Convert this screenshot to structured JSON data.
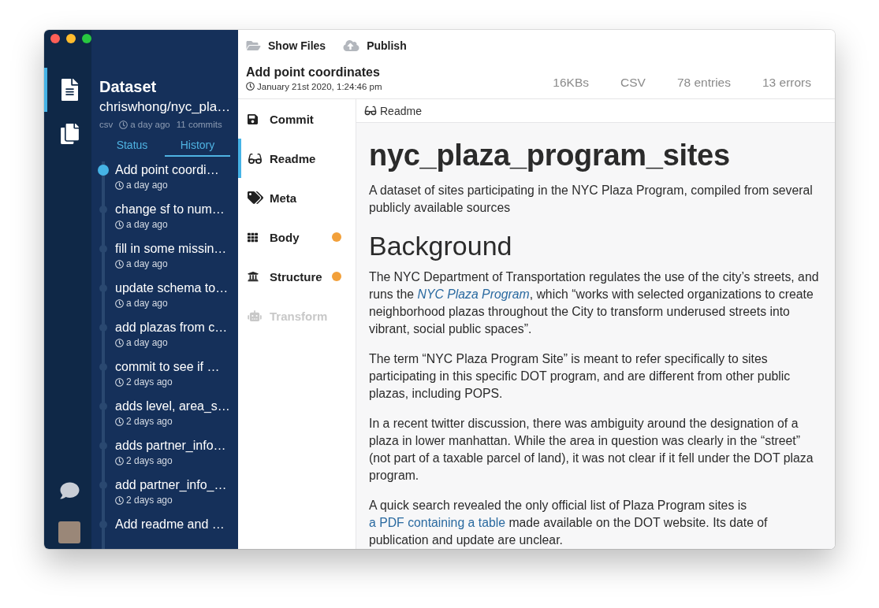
{
  "rail": [
    {
      "selected": true
    },
    {
      "selected": false
    }
  ],
  "sidebar": {
    "title": "Dataset",
    "name": "chriswhong/nyc_pla…",
    "format": "csv",
    "updated": "a day ago",
    "commits": "11 commits"
  },
  "history_tabs": [
    {
      "label": "Status",
      "selected": false
    },
    {
      "label": "History",
      "selected": true
    }
  ],
  "history": [
    {
      "message": "Add point coordi…",
      "time": "a day ago",
      "selected": true
    },
    {
      "message": "change sf to num…",
      "time": "a day ago",
      "selected": false
    },
    {
      "message": "fill in some missin…",
      "time": "a day ago",
      "selected": false
    },
    {
      "message": "update schema to…",
      "time": "a day ago",
      "selected": false
    },
    {
      "message": "add plazas from c…",
      "time": "a day ago",
      "selected": false
    },
    {
      "message": "commit to see if …",
      "time": "2 days ago",
      "selected": false
    },
    {
      "message": "adds level, area_s…",
      "time": "2 days ago",
      "selected": false
    },
    {
      "message": "adds partner_info…",
      "time": "2 days ago",
      "selected": false
    },
    {
      "message": "add partner_info_…",
      "time": "2 days ago",
      "selected": false
    },
    {
      "message": "Add readme and …",
      "selected": false
    }
  ],
  "toolbar": [
    "Show Files",
    "Publish"
  ],
  "commit": {
    "title": "Add point coordinates",
    "timestamp": "January 21st 2020, 1:24:46 pm",
    "stats": [
      "16KBs",
      "CSV",
      "78 entries",
      "13 errors"
    ]
  },
  "sections": [
    {
      "label": "Commit",
      "selected": false,
      "disabled": false,
      "changed": false
    },
    {
      "label": "Readme",
      "selected": true,
      "disabled": false,
      "changed": false
    },
    {
      "label": "Meta",
      "selected": false,
      "disabled": false,
      "changed": false
    },
    {
      "label": "Body",
      "selected": false,
      "disabled": false,
      "changed": true
    },
    {
      "label": "Structure",
      "selected": false,
      "disabled": false,
      "changed": true
    },
    {
      "label": "Transform",
      "selected": false,
      "disabled": true,
      "changed": false
    }
  ],
  "readme": {
    "header": "Readme",
    "blocks": [
      {
        "kind": "title",
        "text": "nyc_plaza_program_sites"
      },
      {
        "kind": "paragraph",
        "parts": [
          {
            "text": "A dataset of sites participating in the NYC Plaza Program, compiled from several publicly available sources",
            "link": false
          }
        ]
      },
      {
        "kind": "heading",
        "text": "Background"
      },
      {
        "kind": "paragraph",
        "parts": [
          {
            "text": "The NYC Department of Transportation regulates the use of the city’s streets, and runs the ",
            "link": false
          },
          {
            "text": "*NYC Plaza Program*",
            "link": true
          },
          {
            "text": ", which “works with selected organizations to create neighborhood plazas throughout the City to transform underused streets into vibrant, social public spaces”.",
            "link": false
          }
        ]
      },
      {
        "kind": "paragraph",
        "parts": [
          {
            "text": "The term “NYC Plaza Program Site” is meant to refer specifically to sites participating in this specific DOT program, and are different from other public plazas, including POPS.",
            "link": false
          }
        ]
      },
      {
        "kind": "paragraph",
        "parts": [
          {
            "text": "In a recent twitter discussion, there was ambiguity around the designation of a plaza in lower manhattan. While the area in question was clearly in the “street” (not part of a taxable parcel of land), it was not clear if it fell under the DOT plaza program.",
            "link": false
          }
        ]
      },
      {
        "kind": "paragraph",
        "parts": [
          {
            "text": "A quick search revealed the only official list of Plaza Program sites is ",
            "link": false
          },
          {
            "text": "a PDF containing a table",
            "link": true
          },
          {
            "text": " made available on the DOT website. Its date of publication and update are unclear.",
            "link": false
          }
        ]
      }
    ]
  }
}
